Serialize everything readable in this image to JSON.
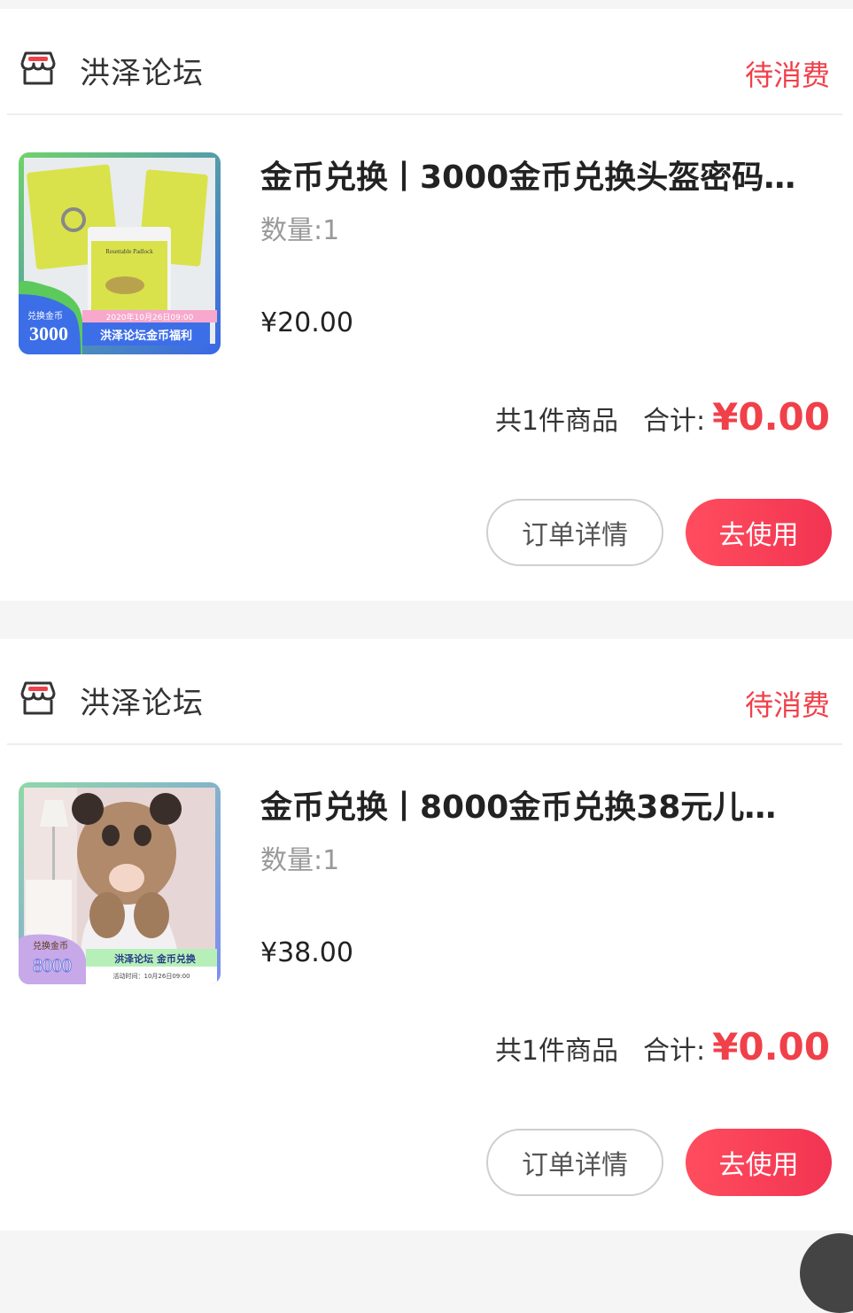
{
  "orders": [
    {
      "shop_name": "洪泽论坛",
      "shop_icon": "shop-icon",
      "status": "待消费",
      "product_title": "金币兑换丨3000金币兑换头盔密码…",
      "quantity": "数量:1",
      "unit_price": "¥20.00",
      "item_count": "共1件商品",
      "total_label": "合计:",
      "total_amount": "¥0.00",
      "detail_button": "订单详情",
      "use_button": "去使用",
      "thumbnail": {
        "badge_label": "兑换金币",
        "badge_value": "3000",
        "date_text": "2020年10月26日09:00",
        "banner_text": "洪泽论坛金币福利",
        "product_label": "Resettable Padlock"
      }
    },
    {
      "shop_name": "洪泽论坛",
      "shop_icon": "shop-icon",
      "status": "待消费",
      "product_title": "金币兑换丨8000金币兑换38元儿…",
      "quantity": "数量:1",
      "unit_price": "¥38.00",
      "item_count": "共1件商品",
      "total_label": "合计:",
      "total_amount": "¥0.00",
      "detail_button": "订单详情",
      "use_button": "去使用",
      "thumbnail": {
        "badge_label": "兑换金币",
        "badge_value": "8000",
        "banner_text": "洪泽论坛 金币兑换",
        "date_text": "活动时间：10月26日09:00"
      }
    }
  ],
  "colors": {
    "accent": "#f0404a",
    "background": "#f5f5f5"
  }
}
